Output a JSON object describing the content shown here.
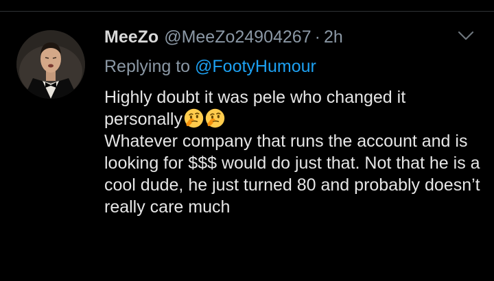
{
  "tweet": {
    "display_name": "MeeZo",
    "handle": "@MeeZo24904267",
    "separator": "·",
    "time": "2h",
    "replying_prefix": "Replying to",
    "replying_to": "@FootyHumour",
    "text_line1": "Highly doubt it was pele who changed it",
    "text_line2": "personally",
    "text_para2": "Whatever company that runs the account and is looking for $$$ would do just that. Not that he is a cool dude, he just turned 80 and probably doesn’t really care much",
    "emoji": [
      "thinking-face",
      "thinking-face"
    ]
  },
  "colors": {
    "background": "#000000",
    "text": "#e6e6e6",
    "secondary": "#8b98a5",
    "link": "#1da1f2",
    "divider": "#2f3336"
  },
  "icons": [
    "avatar",
    "chevron-down-icon",
    "thinking-face-emoji"
  ]
}
